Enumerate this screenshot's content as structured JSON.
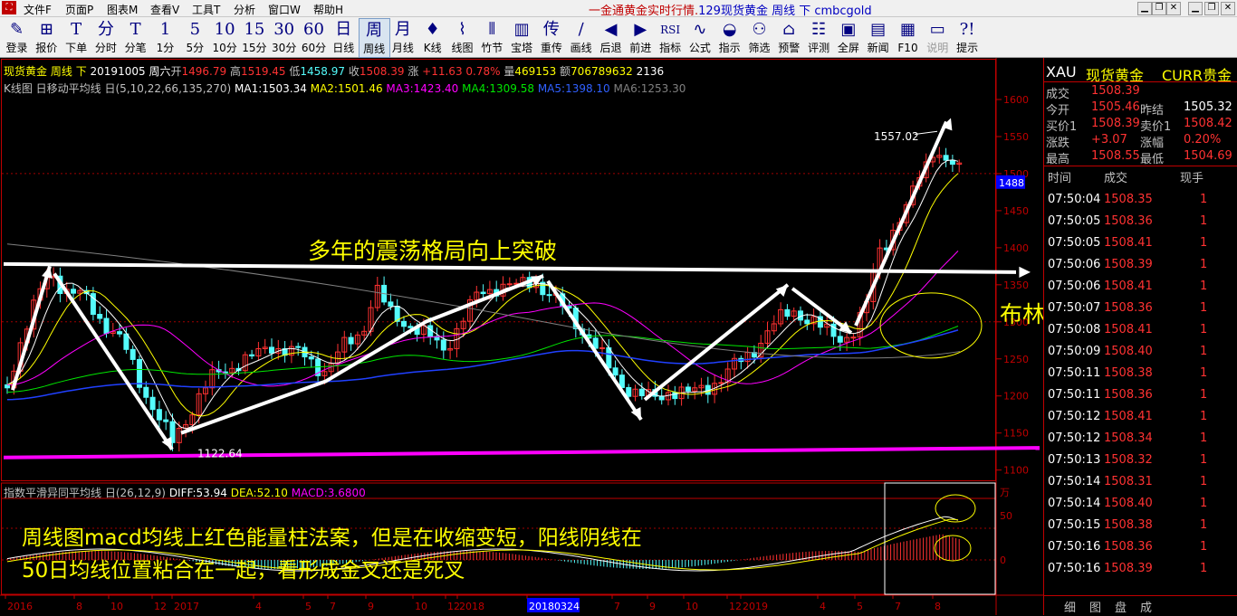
{
  "menu": {
    "items": [
      "文件F",
      "页面P",
      "图表M",
      "查看V",
      "工具T",
      "分析",
      "窗口W",
      "帮助H"
    ],
    "title_prefix": "一金通黄金实时行情.",
    "title_main": "129现货黄金 周线 下 cmbcgold"
  },
  "toolbar": {
    "buttons": [
      {
        "g": "✎",
        "l": "登录"
      },
      {
        "g": "⊞",
        "l": "报价"
      },
      {
        "g": "T",
        "l": "下单"
      },
      {
        "g": "分",
        "l": "分时"
      },
      {
        "g": "T",
        "l": "分笔"
      },
      {
        "g": "1",
        "l": "1分"
      },
      {
        "g": "5",
        "l": "5分"
      },
      {
        "g": "10",
        "l": "10分"
      },
      {
        "g": "15",
        "l": "15分"
      },
      {
        "g": "30",
        "l": "30分"
      },
      {
        "g": "60",
        "l": "60分"
      },
      {
        "g": "日",
        "l": "日线"
      },
      {
        "g": "周",
        "l": "周线"
      },
      {
        "g": "月",
        "l": "月线"
      },
      {
        "g": "♦",
        "l": "K线"
      },
      {
        "g": "⌇",
        "l": "线图"
      },
      {
        "g": "⫴",
        "l": "竹节"
      },
      {
        "g": "▥",
        "l": "宝塔"
      },
      {
        "g": "传",
        "l": "重传"
      },
      {
        "g": "∕",
        "l": "画线"
      },
      {
        "g": "◀",
        "l": "后退"
      },
      {
        "g": "▶",
        "l": "前进"
      },
      {
        "g": "RSI",
        "l": "指标"
      },
      {
        "g": "∿",
        "l": "公式"
      },
      {
        "g": "◒",
        "l": "指示"
      },
      {
        "g": "⚇",
        "l": "筛选"
      },
      {
        "g": "⌂",
        "l": "预警"
      },
      {
        "g": "☷",
        "l": "评测"
      },
      {
        "g": "▣",
        "l": "全屏"
      },
      {
        "g": "▤",
        "l": "新闻"
      },
      {
        "g": "▦",
        "l": "F10"
      },
      {
        "g": "▭",
        "l": "说明"
      },
      {
        "g": "?!",
        "l": "提示"
      }
    ],
    "active_label": "周线",
    "disabled_labels": [
      "说明"
    ]
  },
  "stock_info": {
    "name": "现货黄金",
    "period": "周线",
    "dir": "下",
    "date": "20191005",
    "weekday": "周六",
    "open_label": "开",
    "open": "1496.79",
    "high_label": "高",
    "high": "1519.45",
    "low_label": "低",
    "low": "1458.97",
    "close_label": "收",
    "close": "1508.39",
    "change_label": "涨",
    "change": "+11.63",
    "pct": "0.78%",
    "vol_label": "量",
    "vol": "469153",
    "amt_label": "额",
    "amt": "706789632",
    "extra": "2136"
  },
  "ma_line": {
    "label": "K线图 日移动平均线 日(5,10,22,66,135,270)",
    "ma1": "MA1:1503.34",
    "ma2": "MA2:1501.46",
    "ma3": "MA3:1423.40",
    "ma4": "MA4:1309.58",
    "ma5": "MA5:1398.10",
    "ma6": "MA6:1253.30"
  },
  "price_axis": {
    "ticks": [
      "1600",
      "1550",
      "1500",
      "1450",
      "1400",
      "1350",
      "1300",
      "1250",
      "1200",
      "1150",
      "1100"
    ],
    "current": "1488"
  },
  "price_labels": {
    "high": "1557.02",
    "low": "1122.64"
  },
  "macd_line": {
    "label": "指数平滑异同平均线 日(26,12,9)",
    "diff": "DIFF:53.94",
    "dea": "DEA:52.10",
    "macd": "MACD:3.6800"
  },
  "macd_axis": {
    "unit": "万",
    "ticks": [
      "50",
      "0"
    ]
  },
  "time_axis": [
    "2016",
    "8",
    "10",
    "12",
    "2017",
    "4",
    "5",
    "7",
    "9",
    "10",
    "12",
    "2018",
    "20180324",
    "7",
    "9",
    "10",
    "12",
    "2019",
    "4",
    "5",
    "7",
    "8"
  ],
  "annotations": {
    "breakout": "多年的震荡格局向上突破",
    "bollinger": "布林线拐角向上发散",
    "macd_note_1": "周线图macd均线上红色能量柱法案，但是在收缩变短，阳线阴线在",
    "macd_note_2": "50日均线位置粘合在一起，看形成金叉还是死叉"
  },
  "quote": {
    "code": "XAU",
    "name": "现货黄金",
    "market": "CURR贵金",
    "last_label": "成交",
    "last": "1508.39",
    "open_label": "今开",
    "open": "1505.46",
    "prev_label": "昨结",
    "prev": "1505.32",
    "bid_label": "买价1",
    "bid": "1508.39",
    "ask_label": "卖价1",
    "ask": "1508.42",
    "chg_label": "涨跌",
    "chg": "+3.07",
    "pct_label": "涨幅",
    "pct": "0.20%",
    "high_label": "最高",
    "high": "1508.55",
    "low_label": "最低",
    "low": "1504.69"
  },
  "ticks_header": {
    "time": "时间",
    "price": "成交",
    "vol": "现手"
  },
  "ticks": [
    {
      "t": "07:50:04",
      "p": "1508.35",
      "v": "1"
    },
    {
      "t": "07:50:05",
      "p": "1508.36",
      "v": "1"
    },
    {
      "t": "07:50:05",
      "p": "1508.41",
      "v": "1"
    },
    {
      "t": "07:50:06",
      "p": "1508.39",
      "v": "1"
    },
    {
      "t": "07:50:06",
      "p": "1508.41",
      "v": "1"
    },
    {
      "t": "07:50:07",
      "p": "1508.36",
      "v": "1"
    },
    {
      "t": "07:50:08",
      "p": "1508.41",
      "v": "1"
    },
    {
      "t": "07:50:09",
      "p": "1508.40",
      "v": "1"
    },
    {
      "t": "07:50:11",
      "p": "1508.38",
      "v": "1"
    },
    {
      "t": "07:50:11",
      "p": "1508.36",
      "v": "1"
    },
    {
      "t": "07:50:12",
      "p": "1508.41",
      "v": "1"
    },
    {
      "t": "07:50:12",
      "p": "1508.34",
      "v": "1"
    },
    {
      "t": "07:50:13",
      "p": "1508.32",
      "v": "1"
    },
    {
      "t": "07:50:14",
      "p": "1508.31",
      "v": "1"
    },
    {
      "t": "07:50:14",
      "p": "1508.40",
      "v": "1"
    },
    {
      "t": "07:50:15",
      "p": "1508.38",
      "v": "1"
    },
    {
      "t": "07:50:16",
      "p": "1508.36",
      "v": "1"
    },
    {
      "t": "07:50:16",
      "p": "1508.39",
      "v": "1"
    }
  ],
  "bottom_tabs": [
    "细",
    "图",
    "盘",
    "成"
  ],
  "colors": {
    "up": "#ff3232",
    "down": "#54fcfc",
    "ma1": "#ffffff",
    "ma2": "#ffff00",
    "ma3": "#ff00ff",
    "ma4": "#00e600",
    "ma5": "#0000ff",
    "ma6": "#808080",
    "annot": "#ffff00"
  }
}
